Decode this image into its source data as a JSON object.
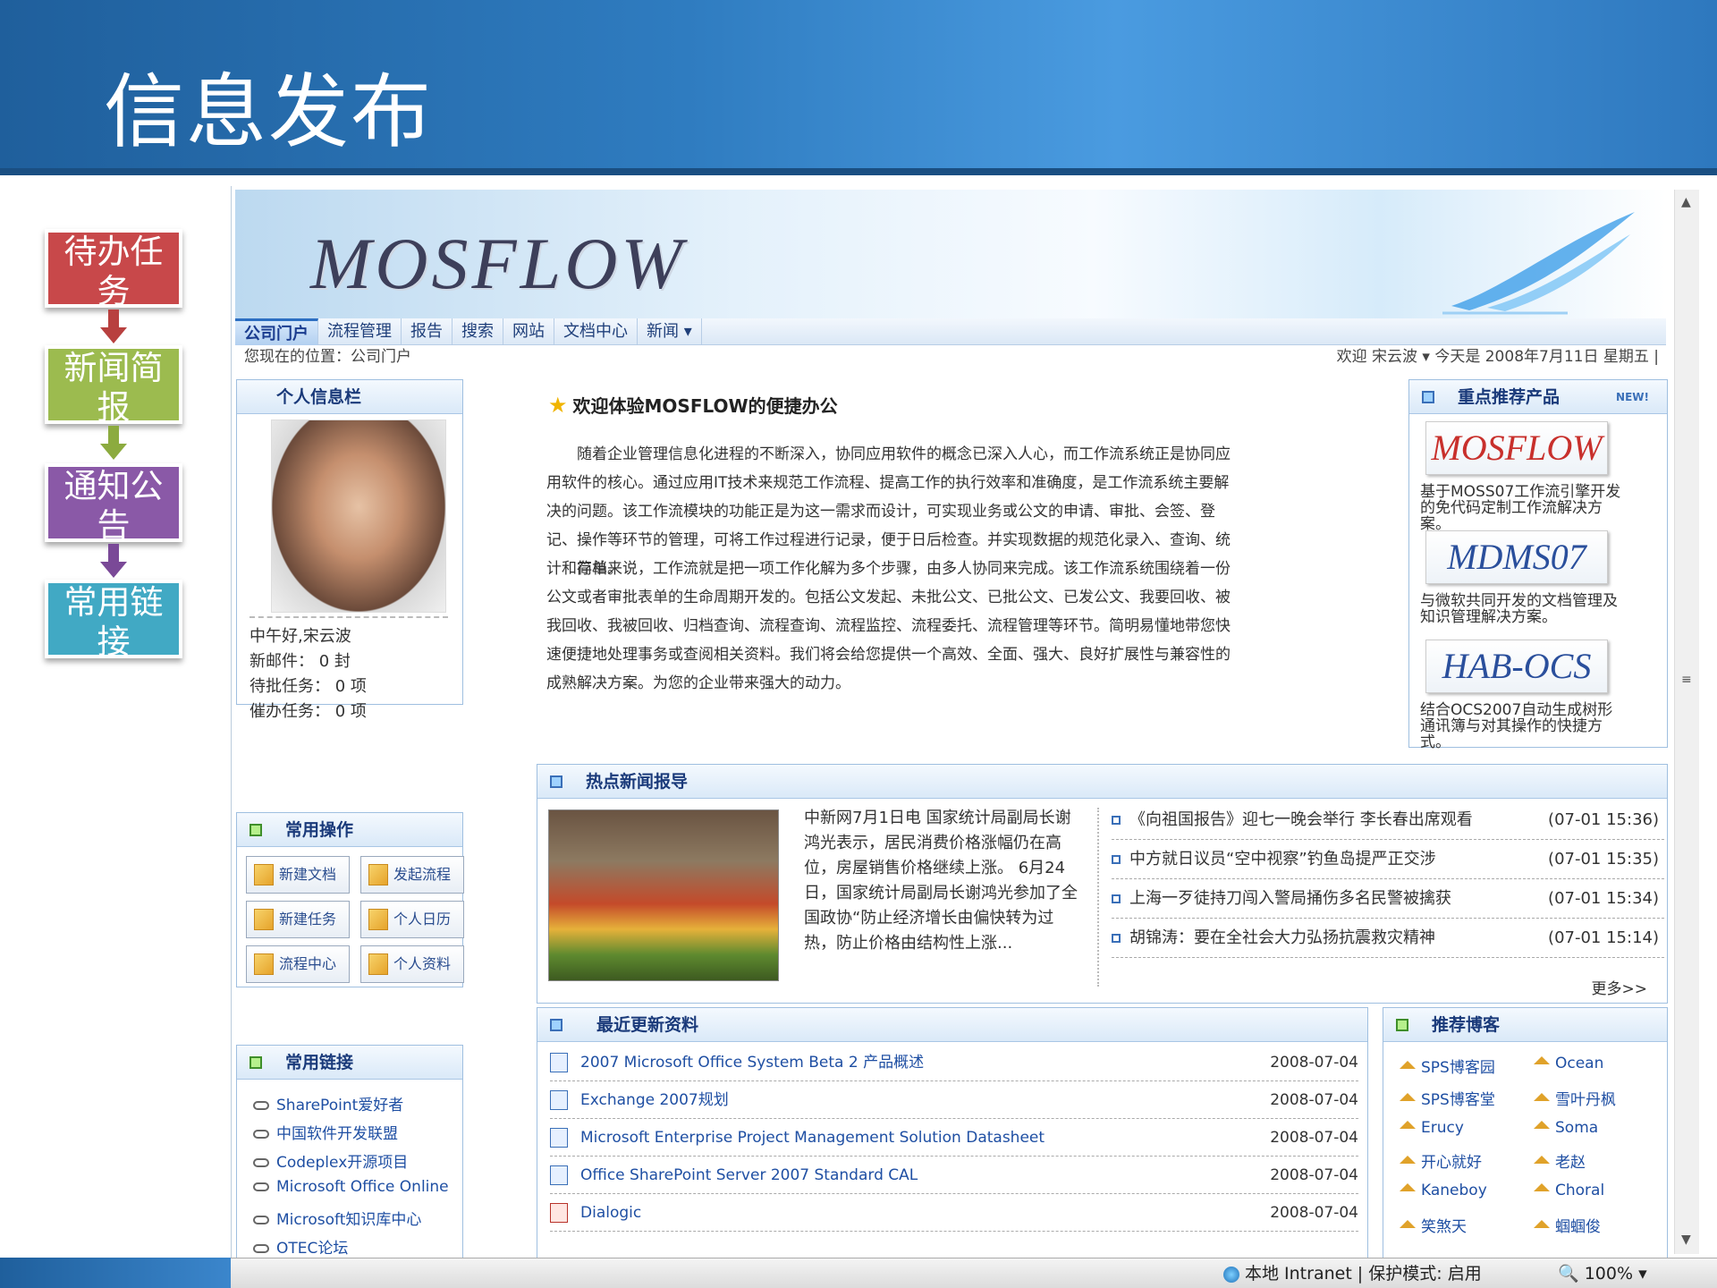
{
  "slide": {
    "title": "信息发布",
    "flow_steps": [
      {
        "label": "待办任务",
        "color": "#c8484a"
      },
      {
        "label": "新闻简报",
        "color": "#9cbb4f"
      },
      {
        "label": "通知公告",
        "color": "#8a59a7"
      },
      {
        "label": "常用链接",
        "color": "#41a9c4"
      }
    ]
  },
  "app": {
    "logo": "MOSFLOW",
    "nav": [
      "公司门户",
      "流程管理",
      "报告",
      "搜索",
      "网站",
      "文档中心",
      "新闻 ▾"
    ],
    "location": "您现在的位置：公司门户",
    "greeting": "欢迎 宋云波 ▾ 今天是 2008年7月11日 星期五 |"
  },
  "personal": {
    "title": "个人信息栏",
    "lines": [
      "中午好,宋云波",
      "新邮件： 0 封",
      "待批任务： 0 项",
      "催办任务： 0 项"
    ]
  },
  "operations": {
    "title": "常用操作",
    "buttons": [
      "新建文档",
      "发起流程",
      "新建任务",
      "个人日历",
      "流程中心",
      "个人资料"
    ]
  },
  "links": {
    "title": "常用链接",
    "items": [
      "SharePoint爱好者",
      "中国软件开发联盟",
      "Codeplex开源项目",
      "Microsoft Office Online",
      "Microsoft知识库中心",
      "OTEC论坛"
    ]
  },
  "welcome": {
    "title": "欢迎体验MOSFLOW的便捷办公",
    "paragraphs": [
      "随着企业管理信息化进程的不断深入，协同应用软件的概念已深入人心，而工作流系统正是协同应用软件的核心。通过应用IT技术来规范工作流程、提高工作的执行效率和准确度，是工作流系统主要解决的问题。该工作流模块的功能正是为这一需求而设计，可实现业务或公文的申请、审批、会签、登记、操作等环节的管理，可将工作过程进行记录，便于日后检查。并实现数据的规范化录入、查询、统计和存档。",
      "简单来说，工作流就是把一项工作化解为多个步骤，由多人协同来完成。该工作流系统围绕着一份公文或者审批表单的生命周期开发的。包括公文发起、未批公文、已批公文、已发公文、我要回收、被我回收、我被回收、归档查询、流程查询、流程监控、流程委托、流程管理等环节。简明易懂地带您快速便捷地处理事务或查阅相关资料。我们将会给您提供一个高效、全面、强大、良好扩展性与兼容性的成熟解决方案。为您的企业带来强大的动力。"
    ]
  },
  "products": {
    "title": "重点推荐产品",
    "badge": "NEW!",
    "items": [
      {
        "logo": "MOSFLOW",
        "desc": "基于MOSS07工作流引擎开发的免代码定制工作流解决方案。",
        "color": "#c8302c"
      },
      {
        "logo": "MDMS07",
        "desc": "与微软共同开发的文档管理及知识管理解决方案。",
        "color": "#2a4f9c"
      },
      {
        "logo": "HAB-OCS",
        "desc": "结合OCS2007自动生成树形通讯簿与对其操作的快捷方式。",
        "color": "#2a4f9c"
      }
    ]
  },
  "hot_news": {
    "title": "热点新闻报导",
    "summary": "中新网7月1日电 国家统计局副局长谢鸿光表示，居民消费价格涨幅仍在高位，房屋销售价格继续上涨。 6月24日，国家统计局副局长谢鸿光参加了全国政协“防止经济增长由偏快转为过热，防止价格由结构性上涨...",
    "items": [
      {
        "title": "《向祖国报告》迎七一晚会举行 李长春出席观看",
        "time": "(07-01 15:36)"
      },
      {
        "title": "中方就日议员“空中视察”钓鱼岛提严正交涉",
        "time": "(07-01 15:35)"
      },
      {
        "title": "上海一歹徒持刀闯入警局捅伤多名民警被擒获",
        "time": "(07-01 15:34)"
      },
      {
        "title": "胡锦涛：要在全社会大力弘扬抗震救灾精神",
        "time": "(07-01 15:14)"
      }
    ],
    "more": "更多>>"
  },
  "recent_docs": {
    "title": "最近更新资料",
    "items": [
      {
        "name": "2007 Microsoft Office System Beta 2 产品概述",
        "date": "2008-07-04",
        "type": "word"
      },
      {
        "name": "Exchange 2007规划",
        "date": "2008-07-04",
        "type": "word"
      },
      {
        "name": "Microsoft Enterprise Project Management Solution Datasheet",
        "date": "2008-07-04",
        "type": "word"
      },
      {
        "name": "Office SharePoint Server 2007 Standard CAL",
        "date": "2008-07-04",
        "type": "word"
      },
      {
        "name": "Dialogic",
        "date": "2008-07-04",
        "type": "pdf"
      }
    ]
  },
  "blogs": {
    "title": "推荐博客",
    "left": [
      "SPS博客园",
      "SPS博客堂",
      "Erucy",
      "开心就好",
      "Kaneboy",
      "笑煞天"
    ],
    "right": [
      "Ocean",
      "雪叶丹枫",
      "Soma",
      "老赵",
      "Choral",
      "蝈蝈俊"
    ]
  },
  "status": {
    "zone": "本地 Intranet | 保护模式: 启用",
    "zoom": "100%"
  }
}
